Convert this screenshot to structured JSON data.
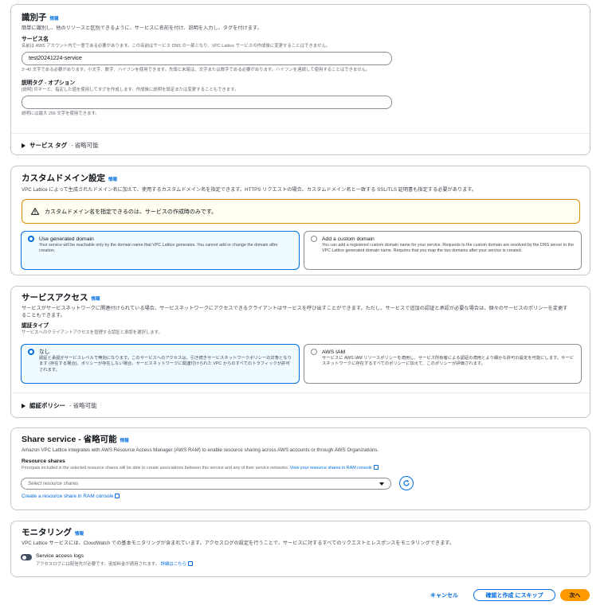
{
  "identifier": {
    "title": "識別子",
    "info": "情報",
    "description": "簡単に識別し、他のリソースと区別できるように、サービスに名前を付け、説明を入力し、タグを付けます。",
    "name_label": "サービス名",
    "name_help": "名前は AWS アカウント内で一意である必要があります。この名前はサービス DNS の一部となり、VPC Lattice サービスの作成後に変更することはできません。",
    "name_value": "test20241224-service",
    "name_constraint": "3~40 文字である必要があります。小文字、数字、ハイフンを使用できます。先頭と末尾は、文字または数字である必要があります。ハイフンを連続して使用することはできません。",
    "desc_label": "説明タグ - オプション",
    "desc_help": "[説明] のキーと、指定した値を使用してタグを作成します。作成後に説明を設定または変更することもできます。",
    "desc_value": "",
    "desc_constraint": "説明には最大 256 文字を使用できます。",
    "tags_expander": "サービス タグ",
    "tags_optional": "- 省略可能"
  },
  "custom_domain": {
    "title": "カスタムドメイン設定",
    "info": "情報",
    "description": "VPC Lattice によって生成されたドメイン名に加えて、使用するカスタムドメイン名を指定できます。HTTPS リクエストの場合、カスタムドメイン名と一致する SSL/TLS 証明書も指定する必要があります。",
    "warning": "カスタムドメイン名を指定できるのは、サービスの作成時のみです。",
    "options": [
      {
        "title": "Use generated domain",
        "desc": "Your service will be reachable only by the domain name that VPC Lattice generates. You cannot add or change the domain after creation.",
        "selected": true
      },
      {
        "title": "Add a custom domain",
        "desc": "You can add a registered custom domain name for your service. Requests to the custom domain are resolved by the DNS server to the VPC Lattice generated domain name. Requires that you map the two domains after your service is created.",
        "selected": false
      }
    ]
  },
  "service_access": {
    "title": "サービスアクセス",
    "info": "情報",
    "description": "サービスがサービスネットワークに関連付けられている場合、サービスネットワークにアクセスできるクライアントはサービスを呼び出すことができます。ただし、サービスで追加の認証と承認が必要な場合は、個々のサービスのポリシーを変更することもできます。",
    "auth_label": "認証タイプ",
    "auth_help": "サービスへのクライアントアクセスを管理する認証と承認を選択します。",
    "options": [
      {
        "title": "なし",
        "desc": "認証と承認がサービスレベルで無効になります。このサービスへのアクセスは、引き続きサービスネットワークポリシーの対象となります (存在する場合)。ポリシーが存在しない場合、サービスネットワークに関連付けられた VPC からのすべてのトラフィックが許可されます。",
        "selected": true
      },
      {
        "title": "AWS IAM",
        "desc": "サービスに AWS IAM リソースポリシーを適用し、サービス所有者による認証の適用とより細かな許可の設定を可能にします。サービスネットワークに存在するすべてのポリシーに加えて、このポリシーが評価されます。",
        "selected": false
      }
    ],
    "policy_expander": "認証ポリシー",
    "policy_optional": "- 省略可能"
  },
  "share": {
    "title": "Share service - 省略可能",
    "info": "情報",
    "description": "Amazon VPC Lattice integrates with AWS Resource Access Manager (AWS RAM) to enable resource sharing across AWS accounts or through AWS Organizations.",
    "label": "Resource shares",
    "help": "Principals included in the selected resource shares will be able to create associations between this service and any of their service networks.",
    "help_link": "View your resource shares in RAM console",
    "placeholder": "Select resource shares",
    "create_link": "Create a resource share in RAM console"
  },
  "monitoring": {
    "title": "モニタリング",
    "info": "情報",
    "description": "VPC Lattice サービスには、CloudWatch での基本モニタリングが含まれています。アクセスログの設定を行うことで、サービスに対するすべてのリクエストとレスポンスをモニタリングできます。",
    "toggle_label": "Service access logs",
    "toggle_help": "アクセスログには配信先が必要です。追加料金が適用されます。",
    "toggle_link": "詳細はこちら"
  },
  "footer": {
    "cancel": "キャンセル",
    "skip": "確認と作成 にスキップ",
    "next": "次へ"
  },
  "colors": {
    "accent": "#006ce0",
    "primary": "#ff9900",
    "warning_border": "#db8c00"
  }
}
